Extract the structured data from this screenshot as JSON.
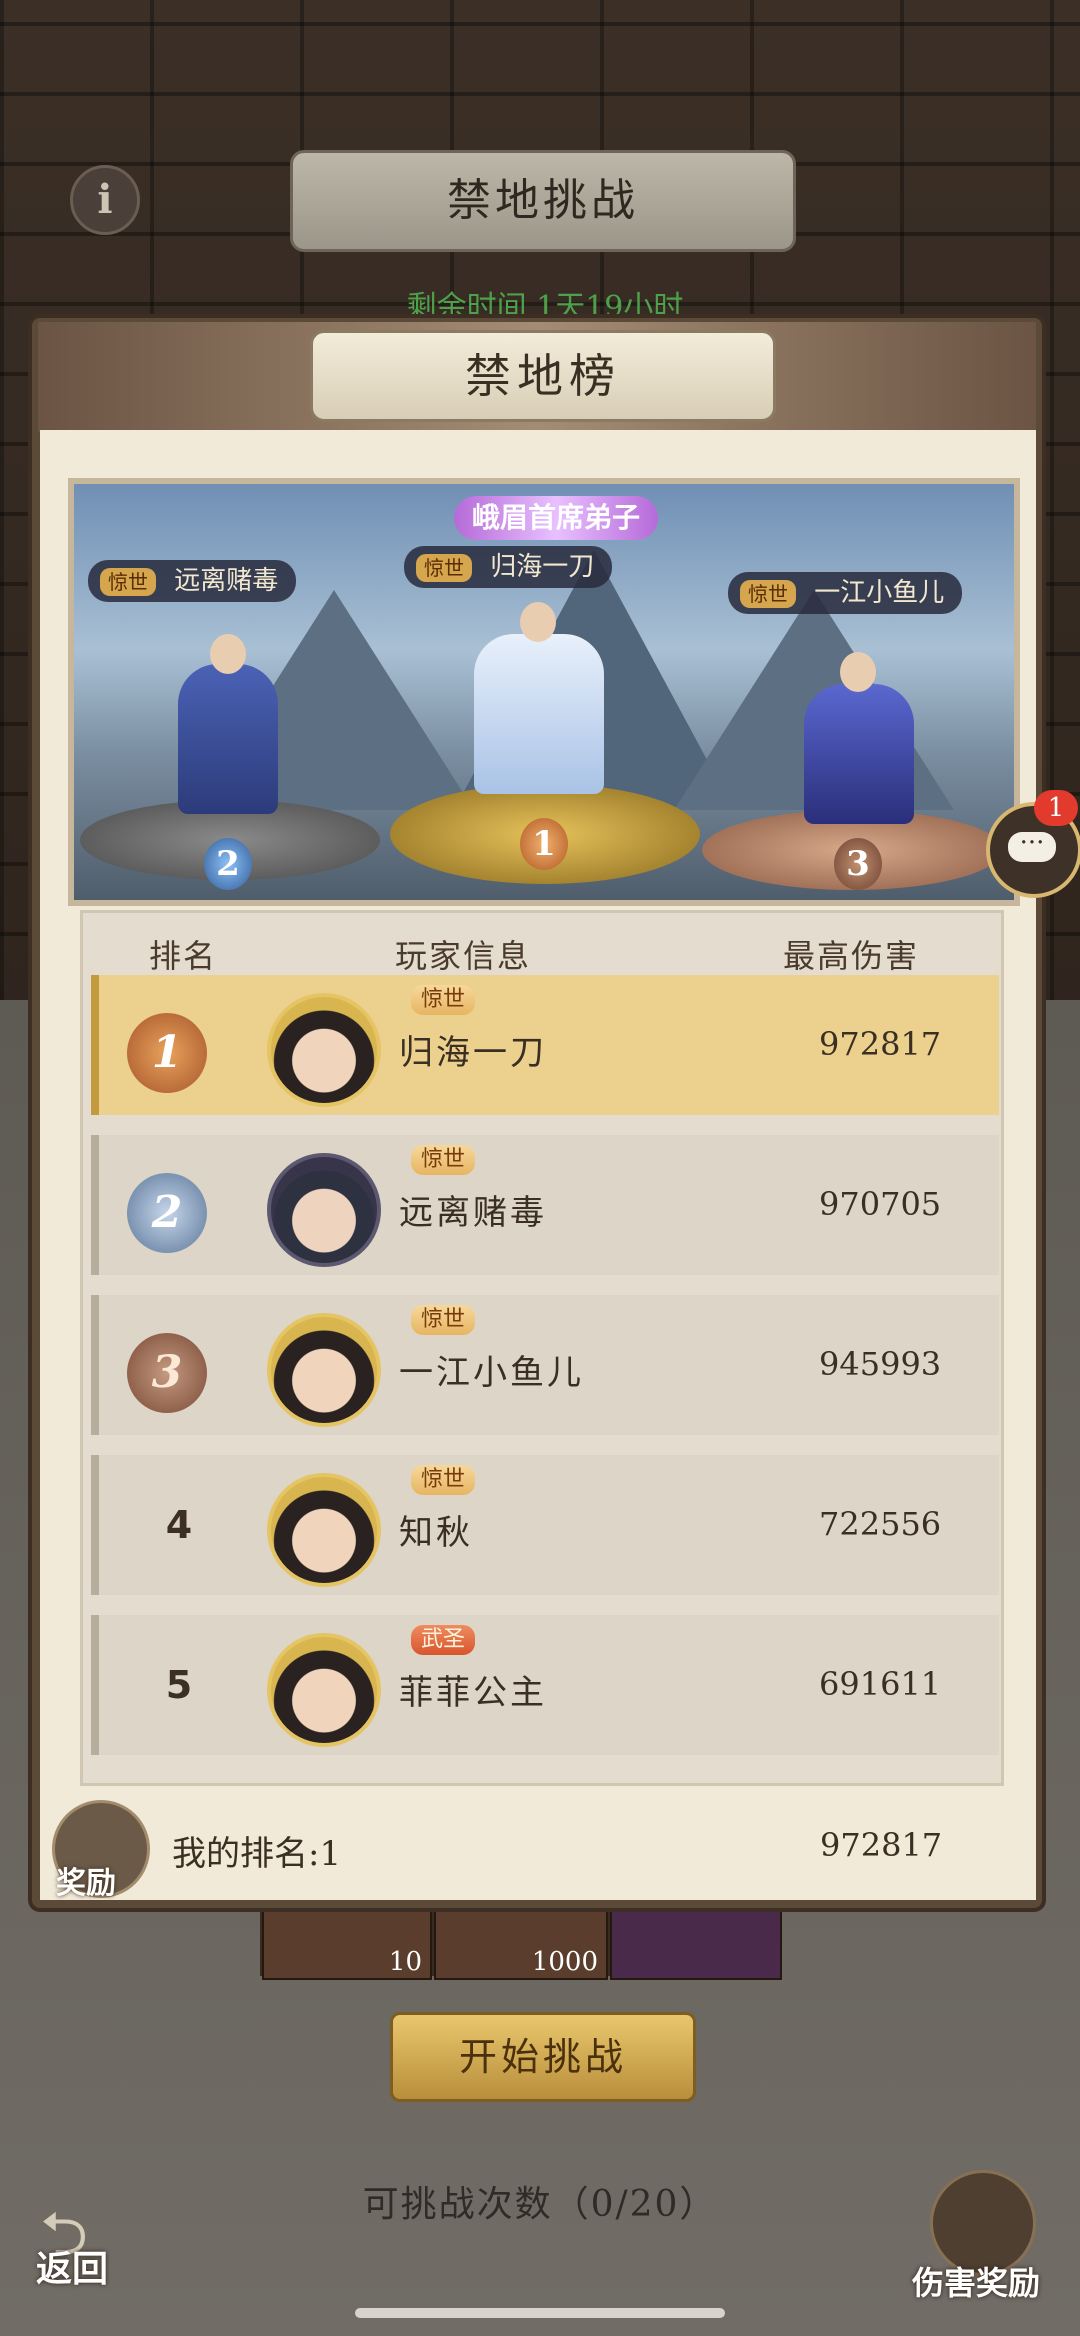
{
  "header": {
    "title": "禁地挑战",
    "remaining_time": "剩余时间 1天19小时"
  },
  "modal": {
    "title": "禁地榜",
    "podium": {
      "title_badge": "峨眉首席弟子",
      "entries": [
        {
          "rank": "1",
          "tier": "惊世",
          "name": "归海一刀"
        },
        {
          "rank": "2",
          "tier": "惊世",
          "name": "远离赌毒"
        },
        {
          "rank": "3",
          "tier": "惊世",
          "name": "一江小鱼儿"
        }
      ]
    },
    "table": {
      "headers": {
        "rank": "排名",
        "player": "玩家信息",
        "damage": "最高伤害"
      },
      "rows": [
        {
          "rank": "1",
          "tier": "惊世",
          "name": "归海一刀",
          "damage": "972817"
        },
        {
          "rank": "2",
          "tier": "惊世",
          "name": "远离赌毒",
          "damage": "970705"
        },
        {
          "rank": "3",
          "tier": "惊世",
          "name": "一江小鱼儿",
          "damage": "945993"
        },
        {
          "rank": "4",
          "tier": "惊世",
          "name": "知秋",
          "damage": "722556"
        },
        {
          "rank": "5",
          "tier": "武圣",
          "name": "菲菲公主",
          "damage": "691611"
        }
      ]
    },
    "my_rank": {
      "label": "我的排名:1",
      "damage": "972817",
      "reward_label": "奖励"
    }
  },
  "chat": {
    "badge": "1"
  },
  "bottom": {
    "items": [
      {
        "count": "10"
      },
      {
        "count": "1000"
      }
    ],
    "start_button": "开始挑战",
    "attempts": "可挑战次数（0/20）",
    "back_label": "返回",
    "damage_reward_label": "伤害奖励"
  },
  "colors": {
    "accent_gold": "#ecd08e",
    "remaining_time_green": "#4ea14a",
    "chat_badge_red": "#e23a2c"
  }
}
